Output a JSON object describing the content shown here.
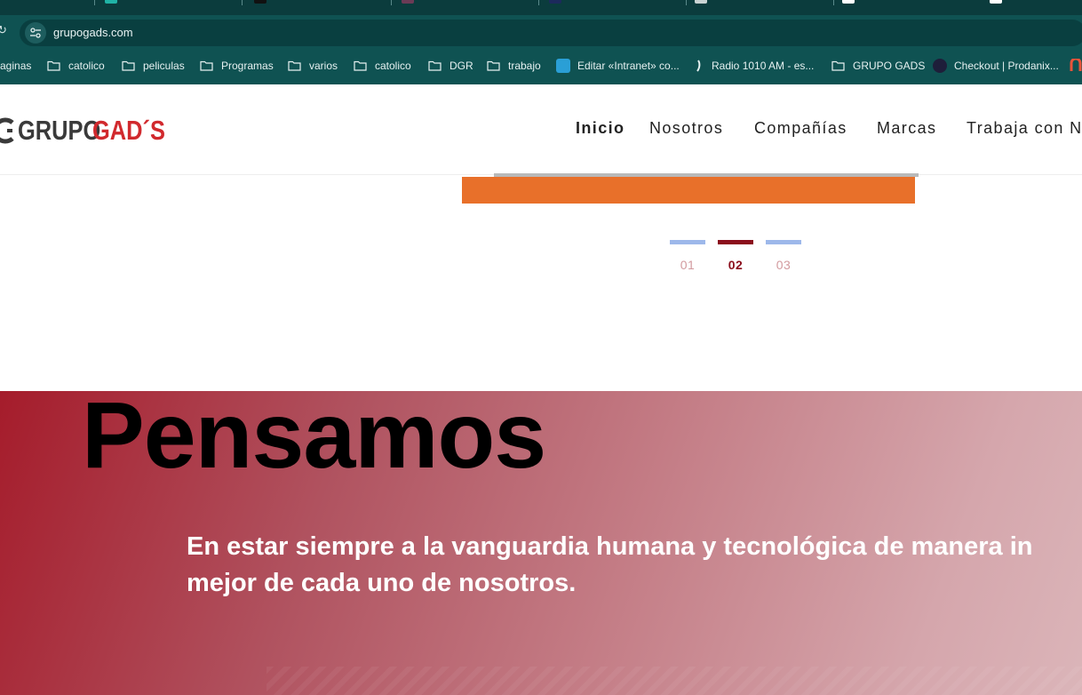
{
  "browser": {
    "url": "grupogads.com",
    "bookmarks": [
      {
        "label": "aginas",
        "icon": "folder-icon"
      },
      {
        "label": "catolico",
        "icon": "folder-icon"
      },
      {
        "label": "peliculas",
        "icon": "folder-icon"
      },
      {
        "label": "Programas",
        "icon": "folder-icon"
      },
      {
        "label": "varios",
        "icon": "folder-icon"
      },
      {
        "label": "catolico",
        "icon": "folder-icon"
      },
      {
        "label": "DGR",
        "icon": "folder-icon"
      },
      {
        "label": "trabajo",
        "icon": "folder-icon"
      },
      {
        "label": "Editar «Intranet» co...",
        "icon": "site-favicon-icon"
      },
      {
        "label": "Radio 1010 AM - es...",
        "icon": "radio-favicon-icon"
      },
      {
        "label": "GRUPO GADS",
        "icon": "folder-icon"
      },
      {
        "label": "Checkout | Prodanix...",
        "icon": "checkout-favicon-icon"
      }
    ]
  },
  "header": {
    "logo_text_1": "GRUPO",
    "logo_text_2": "GAD´S",
    "nav": [
      "Inicio",
      "Nosotros",
      "Compañías",
      "Marcas",
      "Trabaja con N"
    ]
  },
  "slider": {
    "indicators": [
      {
        "label": "01",
        "active": false
      },
      {
        "label": "02",
        "active": true
      },
      {
        "label": "03",
        "active": false
      }
    ],
    "colors": {
      "active": "#8b0e1c",
      "inactive": "#9db8ea",
      "inactive_text": "#d29a9e",
      "accent_bar": "#e8702a"
    }
  },
  "section": {
    "title": "Pensamos",
    "line1": "En estar siempre a la vanguardia humana y tecnológica de manera in",
    "line2": "mejor de cada uno de nosotros."
  }
}
